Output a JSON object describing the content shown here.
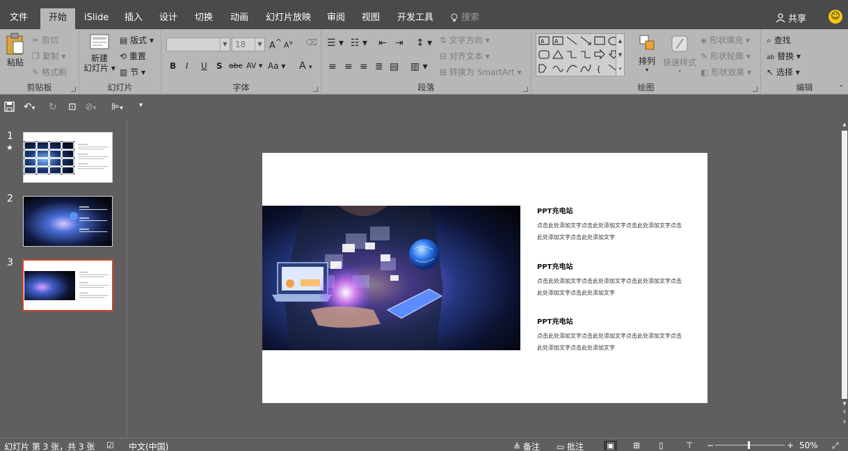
{
  "tabs": {
    "file": "文件",
    "home": "开始",
    "islide": "iSlide",
    "insert": "插入",
    "design": "设计",
    "transitions": "切换",
    "animations": "动画",
    "slideshow": "幻灯片放映",
    "review": "审阅",
    "view": "视图",
    "developer": "开发工具",
    "search": "搜索",
    "share": "共享"
  },
  "ribbon": {
    "clipboard": {
      "label": "剪贴板",
      "paste": "粘贴",
      "cut": "剪切",
      "copy": "复制",
      "format_painter": "格式刷"
    },
    "slides": {
      "label": "幻灯片",
      "new_slide_line1": "新建",
      "new_slide_line2": "幻灯片",
      "layout": "版式",
      "reset": "重置",
      "section": "节"
    },
    "font": {
      "label": "字体",
      "font_size": "18",
      "bold": "B",
      "italic": "I",
      "underline": "U",
      "shadow": "S",
      "strikethrough": "abc",
      "spacing": "AV",
      "case": "Aa",
      "grow": "A",
      "shrink": "A",
      "color": "A"
    },
    "paragraph": {
      "label": "段落",
      "text_direction": "文字方向",
      "align_text": "对齐文本",
      "convert_smartart": "转换为 SmartArt"
    },
    "drawing": {
      "label": "绘图",
      "arrange": "排列",
      "quick_styles": "快速样式",
      "shape_fill": "形状填充",
      "shape_outline": "形状轮廓",
      "shape_effects": "形状效果"
    },
    "editing": {
      "label": "编辑",
      "find": "查找",
      "replace": "替换",
      "select": "选择"
    }
  },
  "thumbnails": [
    {
      "number": "1",
      "star": "★"
    },
    {
      "number": "2",
      "star": ""
    },
    {
      "number": "3",
      "star": ""
    }
  ],
  "slide": {
    "sections": [
      {
        "title": "PPT充电站",
        "body": "点击此处添加文字点击此处添加文字点击此处添加文字点击此处添加文字点击此处添加文字"
      },
      {
        "title": "PPT充电站",
        "body": "点击此处添加文字点击此处添加文字点击此处添加文字点击此处添加文字点击此处添加文字"
      },
      {
        "title": "PPT充电站",
        "body": "点击此处添加文字点击此处添加文字点击此处添加文字点击此处添加文字点击此处添加文字"
      }
    ]
  },
  "status": {
    "slide_info": "幻灯片 第 3 张，共 3 张",
    "language": "中文(中国)",
    "notes": "备注",
    "comments": "批注",
    "zoom": "50%"
  },
  "colors": {
    "tab_bar": "#4a4a4a",
    "ribbon": "#b7b7b7",
    "workspace": "#5f5f5f",
    "selected_thumb_border": "#d24726"
  }
}
